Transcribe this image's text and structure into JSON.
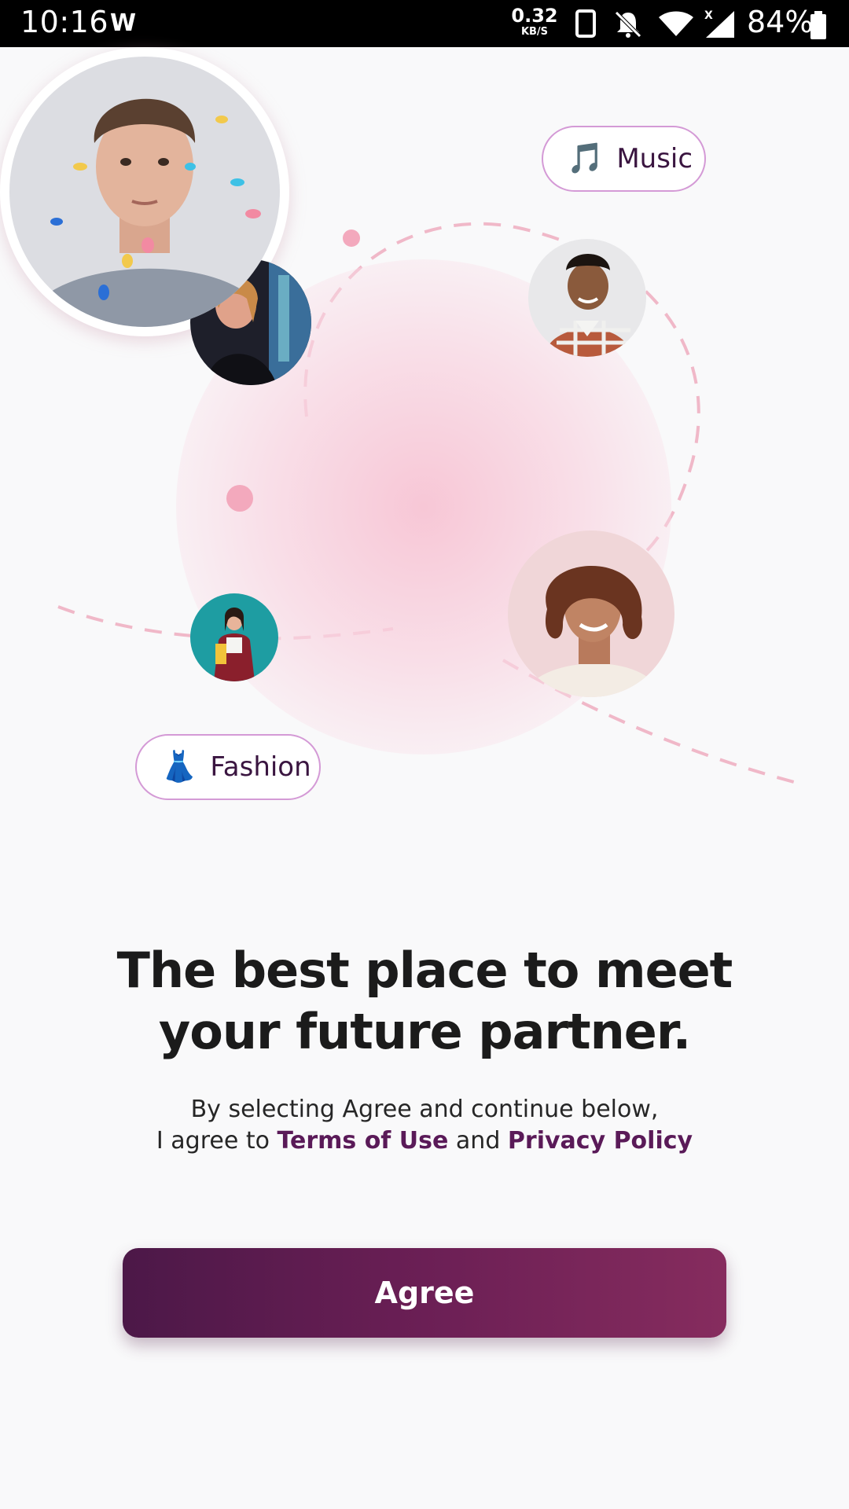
{
  "status_bar": {
    "time": "10:16",
    "app_icon": "W",
    "net_speed": "0.32",
    "net_unit": "KB/S",
    "battery_pct": "84%"
  },
  "tags": {
    "music": {
      "emoji": "🎵",
      "label": "Music"
    },
    "fashion": {
      "emoji": "👗",
      "label": "Fashion"
    }
  },
  "headline": {
    "line1": "The best place to meet",
    "line2": "your future partner."
  },
  "consent": {
    "line1": "By selecting Agree and continue below,",
    "prefix": "I agree to",
    "terms_link": "Terms of Use",
    "and": "and",
    "privacy_link": "Privacy Policy"
  },
  "agree_button": {
    "label": "Agree"
  },
  "colors": {
    "accent": "#5a1a58",
    "button_start": "#4c1848",
    "button_end": "#862c5e",
    "tag_border": "#d49ad6",
    "halo": "#f7c4d4"
  }
}
